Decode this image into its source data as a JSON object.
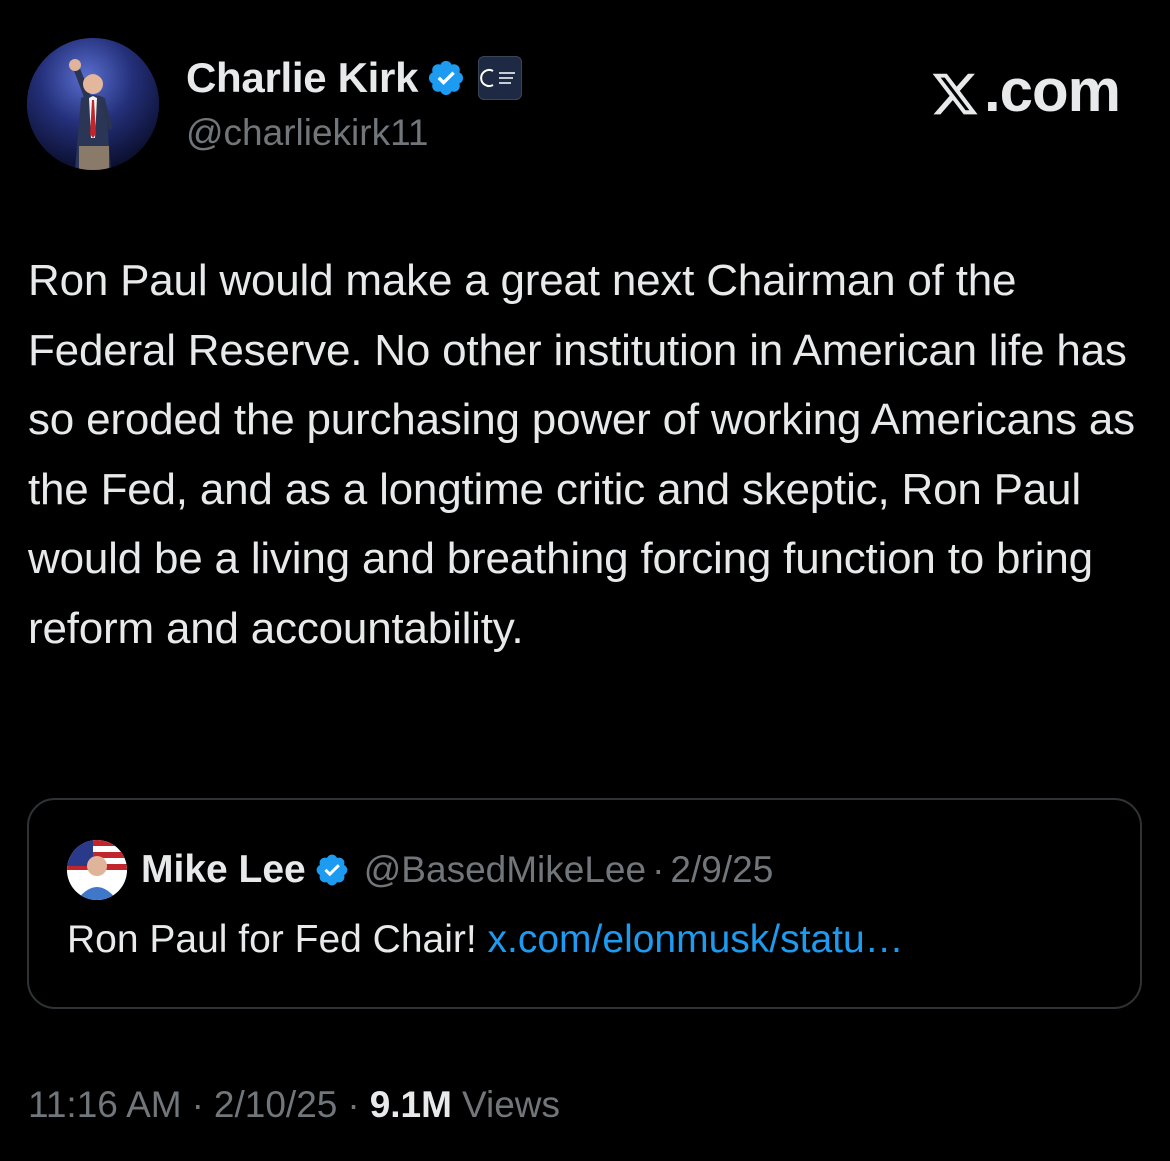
{
  "author": {
    "name": "Charlie Kirk",
    "handle": "@charliekirk11",
    "verified_icon": "verified-badge-icon",
    "affiliation_icon": "turning-point-usa-badge"
  },
  "site": {
    "logo_text": ".com",
    "logo_icon": "x-logo-icon"
  },
  "tweet": {
    "text": "Ron Paul would make a great next Chairman of the Federal Reserve. No other institution in American life has so eroded the purchasing power of working Americans as the Fed, and as a longtime critic and skeptic, Ron Paul would be a living and breathing forcing function to bring reform and accountability."
  },
  "quote": {
    "name": "Mike Lee",
    "handle": "@BasedMikeLee",
    "separator": "·",
    "date": "2/9/25",
    "text": "Ron Paul for Fed Chair! ",
    "link": "x.com/elonmusk/statu…"
  },
  "meta": {
    "time": "11:16 AM",
    "separator": "·",
    "date": "2/10/25",
    "views_count": "9.1M",
    "views_label": "Views"
  },
  "colors": {
    "background": "#000000",
    "text_primary": "#e7e9ea",
    "text_secondary": "#71767b",
    "link": "#1d9bf0",
    "verified": "#1d9bf0",
    "border": "#2f3336"
  }
}
